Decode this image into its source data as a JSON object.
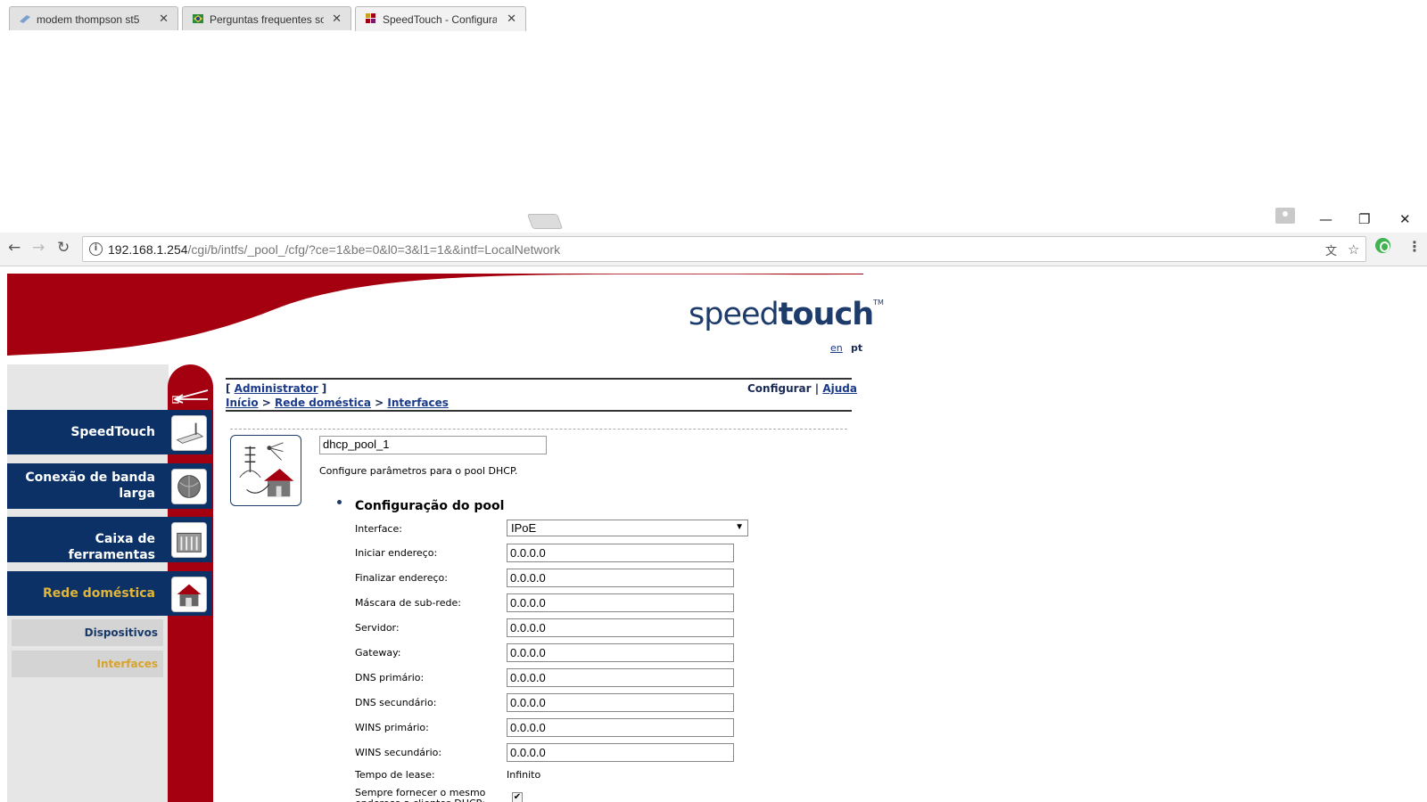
{
  "tabs": [
    {
      "label": "modem thompson st5",
      "active": false
    },
    {
      "label": "Perguntas frequentes sob",
      "active": false
    },
    {
      "label": "SpeedTouch - Configurac",
      "active": true
    }
  ],
  "address_bar": {
    "host": "192.168.1.254",
    "path": "/cgi/b/intfs/_pool_/cfg/?ce=1&be=0&l0=3&l1=1&&intf=LocalNetwork"
  },
  "brand": {
    "light": "speed",
    "bold": "touch",
    "tm": "TM"
  },
  "languages": [
    "en",
    "pt"
  ],
  "nav": {
    "items": [
      {
        "label": "SpeedTouch",
        "active": false
      },
      {
        "label": "Conexão de banda larga",
        "active": false
      },
      {
        "label": "Caixa de ferramentas",
        "active": false
      },
      {
        "label": "Rede doméstica",
        "active": true
      }
    ],
    "subitems": [
      {
        "label": "Dispositivos",
        "active": false
      },
      {
        "label": "Interfaces",
        "active": true
      }
    ]
  },
  "header": {
    "user": "Administrator",
    "breadcrumb": [
      "Início",
      "Rede doméstica",
      "Interfaces"
    ],
    "configure": "Configurar",
    "help": "Ajuda"
  },
  "pool": {
    "name": "dhcp_pool_1",
    "description": "Configure parâmetros para o pool DHCP.",
    "section_title": "Configuração do pool",
    "interface_label": "Interface:",
    "interface_value": "IPoE",
    "fields": [
      {
        "label": "Iniciar endereço:",
        "value": "0.0.0.0"
      },
      {
        "label": "Finalizar endereço:",
        "value": "0.0.0.0"
      },
      {
        "label": "Máscara de sub-rede:",
        "value": "0.0.0.0"
      },
      {
        "label": "Servidor:",
        "value": "0.0.0.0"
      },
      {
        "label": "Gateway:",
        "value": "0.0.0.0"
      },
      {
        "label": "DNS primário:",
        "value": "0.0.0.0"
      },
      {
        "label": "DNS secundário:",
        "value": "0.0.0.0"
      },
      {
        "label": "WINS primário:",
        "value": "0.0.0.0"
      },
      {
        "label": "WINS secundário:",
        "value": "0.0.0.0"
      }
    ],
    "lease_label": "Tempo de lease:",
    "lease_value": "Infinito",
    "always_label": "Sempre fornecer o mesmo endereço a clientes DHCP:",
    "always_checked": true
  },
  "colors": {
    "brand_red": "#a50010",
    "brand_blue": "#0b3166",
    "active_gold": "#e2b537"
  }
}
